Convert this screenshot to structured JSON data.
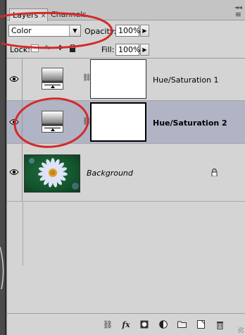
{
  "tabs": [
    {
      "label": "Layers",
      "close": "×"
    },
    {
      "label": "Channels"
    }
  ],
  "header": {
    "collapse_glyph": "◄◄",
    "menu_glyph": "≡"
  },
  "blend_mode": {
    "value": "Color",
    "dropdown_glyph": "▼"
  },
  "opacity": {
    "label": "Opacity:",
    "value": "100%",
    "arrow": "▶"
  },
  "lock": {
    "label": "Lock:"
  },
  "fill": {
    "label": "Fill:",
    "value": "100%",
    "arrow": "▶"
  },
  "layers": [
    {
      "name": "Hue/Saturation 1",
      "type": "adjustment",
      "selected": false,
      "visible": true
    },
    {
      "name": "Hue/Saturation 2",
      "type": "adjustment",
      "selected": true,
      "visible": true
    },
    {
      "name": "Background",
      "type": "image",
      "selected": false,
      "visible": true,
      "locked": true
    }
  ],
  "bottom_toolbar": [
    "link-layers",
    "fx",
    "add-mask",
    "new-adjustment",
    "new-group",
    "new-layer",
    "delete-layer"
  ],
  "colors": {
    "panel_bg": "#d4d4d4",
    "selected_row": "#b1b4c5",
    "annotation": "#d42a2a"
  }
}
